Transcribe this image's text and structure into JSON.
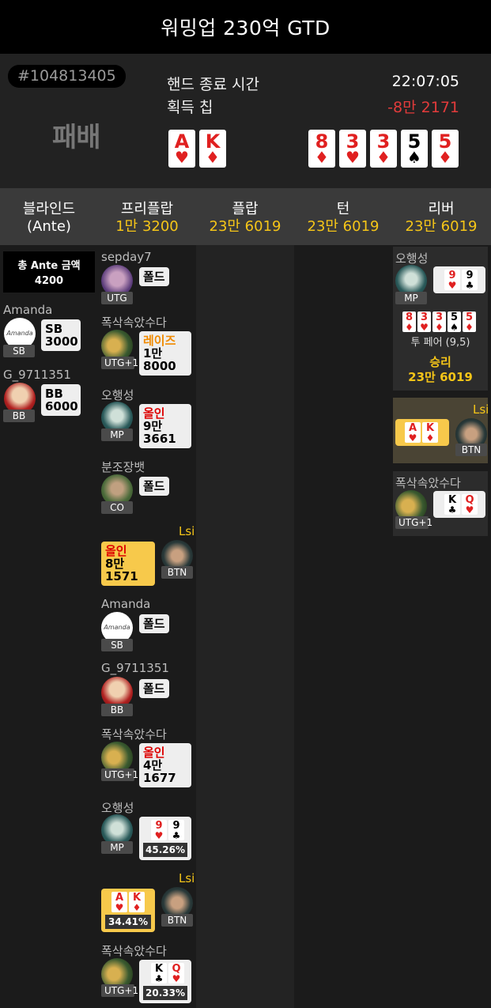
{
  "app_title": "워밍업 230억 GTD",
  "hand": {
    "id": "#104813405",
    "result": "패배",
    "end_time_label": "핸드 종료 시간",
    "end_time": "22:07:05",
    "chips_label": "획득 칩",
    "chips": "-8만 2171",
    "hole_cards": [
      {
        "rank": "A",
        "suit": "♥",
        "color": "red"
      },
      {
        "rank": "K",
        "suit": "♦",
        "color": "red"
      }
    ],
    "best_hand": [
      {
        "rank": "8",
        "suit": "♦",
        "color": "red"
      },
      {
        "rank": "3",
        "suit": "♥",
        "color": "red"
      },
      {
        "rank": "3",
        "suit": "♦",
        "color": "red"
      },
      {
        "rank": "5",
        "suit": "♠",
        "color": "black"
      },
      {
        "rank": "5",
        "suit": "♦",
        "color": "red"
      }
    ]
  },
  "columns": [
    {
      "title": "블라인드",
      "amount": "(Ante)"
    },
    {
      "title": "프리플랍",
      "amount": "1만 3200"
    },
    {
      "title": "플랍",
      "amount": "23만 6019"
    },
    {
      "title": "턴",
      "amount": "23만 6019"
    },
    {
      "title": "리버",
      "amount": "23만 6019"
    }
  ],
  "blinds": {
    "ante_label": "총 Ante 금액",
    "ante_amount": "4200",
    "players": [
      {
        "name": "Amanda",
        "pos": "SB",
        "action": "SB",
        "amount": "3000"
      },
      {
        "name": "G_9711351",
        "pos": "BB",
        "action": "BB",
        "amount": "6000"
      }
    ]
  },
  "preflop": [
    {
      "name": "sepday7",
      "pos": "UTG",
      "action": "폴드"
    },
    {
      "name": "폭삭속았수다",
      "pos": "UTG+1",
      "action": "레이즈",
      "amount_a": "1만",
      "amount_b": "8000"
    },
    {
      "name": "오행성",
      "pos": "MP",
      "action": "올인",
      "amount_a": "9만",
      "amount_b": "3661"
    },
    {
      "name": "분조장뱃",
      "pos": "CO",
      "action": "폴드"
    },
    {
      "name": "Lsi",
      "pos": "BTN",
      "action": "올인",
      "amount_a": "8만",
      "amount_b": "1571"
    },
    {
      "name": "Amanda",
      "pos": "SB",
      "action": "폴드"
    },
    {
      "name": "G_9711351",
      "pos": "BB",
      "action": "폴드"
    },
    {
      "name": "폭삭속았수다",
      "pos": "UTG+1",
      "action": "올인",
      "amount_a": "4만",
      "amount_b": "1677"
    },
    {
      "name": "오행성",
      "pos": "MP",
      "pct": "45.26%"
    },
    {
      "name": "Lsi",
      "pos": "BTN",
      "pct": "34.41%"
    },
    {
      "name": "폭삭속았수다",
      "pos": "UTG+1",
      "pct": "20.33%"
    }
  ],
  "river": {
    "winner_name": "오행성",
    "winner_pos": "MP",
    "hand_name": "투 페어 (9,5)",
    "win_label": "승리",
    "win_amount": "23만 6019",
    "lsi_name": "Lsi",
    "lsi_pos": "BTN",
    "p3_name": "폭삭속았수다",
    "p3_pos": "UTG+1"
  },
  "colors": {
    "accent": "#f5c518",
    "loss": "#e23b3b",
    "header_bg": "#000000",
    "panel_bg": "#222222"
  }
}
